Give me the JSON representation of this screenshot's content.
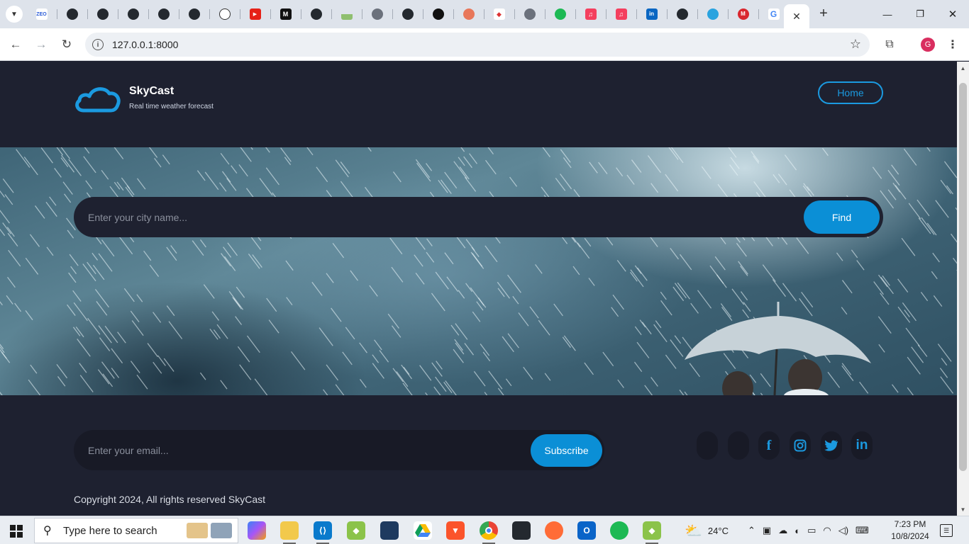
{
  "browser": {
    "tab_icons": [
      "zeo-icon",
      "github-icon",
      "github-icon",
      "github-icon",
      "github-icon",
      "github-icon",
      "openai-icon",
      "youtube-icon",
      "medium-icon",
      "github-icon",
      "chart-icon",
      "globe-icon",
      "github-icon",
      "circle-icon",
      "octopus-icon",
      "gem-icon",
      "globe-icon",
      "spotify-icon",
      "music-icon",
      "music-icon",
      "linkedin-icon",
      "github-icon",
      "telegram-icon",
      "mega-icon",
      "google-icon"
    ],
    "url": "127.0.0.1:8000",
    "profile_initial": "G"
  },
  "header": {
    "brand": "SkyCast",
    "tagline": "Real time weather forecast",
    "home_label": "Home"
  },
  "search": {
    "placeholder": "Enter your city name...",
    "button_label": "Find"
  },
  "footer": {
    "email_placeholder": "Enter your email...",
    "subscribe_label": "Subscribe",
    "social_icons": [
      "blank-icon",
      "blank-icon",
      "facebook-icon",
      "instagram-icon",
      "twitter-icon",
      "linkedin-icon"
    ],
    "copyright": "Copyright 2024, All rights reserved SkyCast"
  },
  "taskbar": {
    "search_text": "Type here to search",
    "weather": "24°C",
    "time": "7:23 PM",
    "date": "10/8/2024"
  },
  "colors": {
    "page_bg": "#1e2130",
    "accent": "#0b8fd6"
  }
}
